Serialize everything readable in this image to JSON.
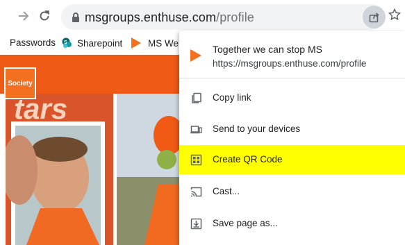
{
  "toolbar": {
    "url_host": "msgroups.enthuse.com",
    "url_path": "/profile"
  },
  "bookmarks": [
    {
      "label": "Passwords",
      "icon": "none"
    },
    {
      "label": "Sharepoint",
      "icon": "sharepoint-icon"
    },
    {
      "label": "MS Web",
      "icon": "play-icon"
    }
  ],
  "page": {
    "banner_text": "tars",
    "logo_text": "Society"
  },
  "share_menu": {
    "title": "Together we can stop MS",
    "url": "https://msgroups.enthuse.com/profile",
    "items": [
      {
        "label": "Copy link",
        "icon": "copy-icon",
        "highlighted": false
      },
      {
        "label": "Send to your devices",
        "icon": "devices-icon",
        "highlighted": false
      },
      {
        "label": "Create QR Code",
        "icon": "qr-code-icon",
        "highlighted": true
      },
      {
        "label": "Cast...",
        "icon": "cast-icon",
        "highlighted": false
      },
      {
        "label": "Save page as...",
        "icon": "save-icon",
        "highlighted": false
      }
    ]
  },
  "colors": {
    "accent": "#f37021",
    "highlight": "#ffff00",
    "banner": "#ef5a17"
  }
}
